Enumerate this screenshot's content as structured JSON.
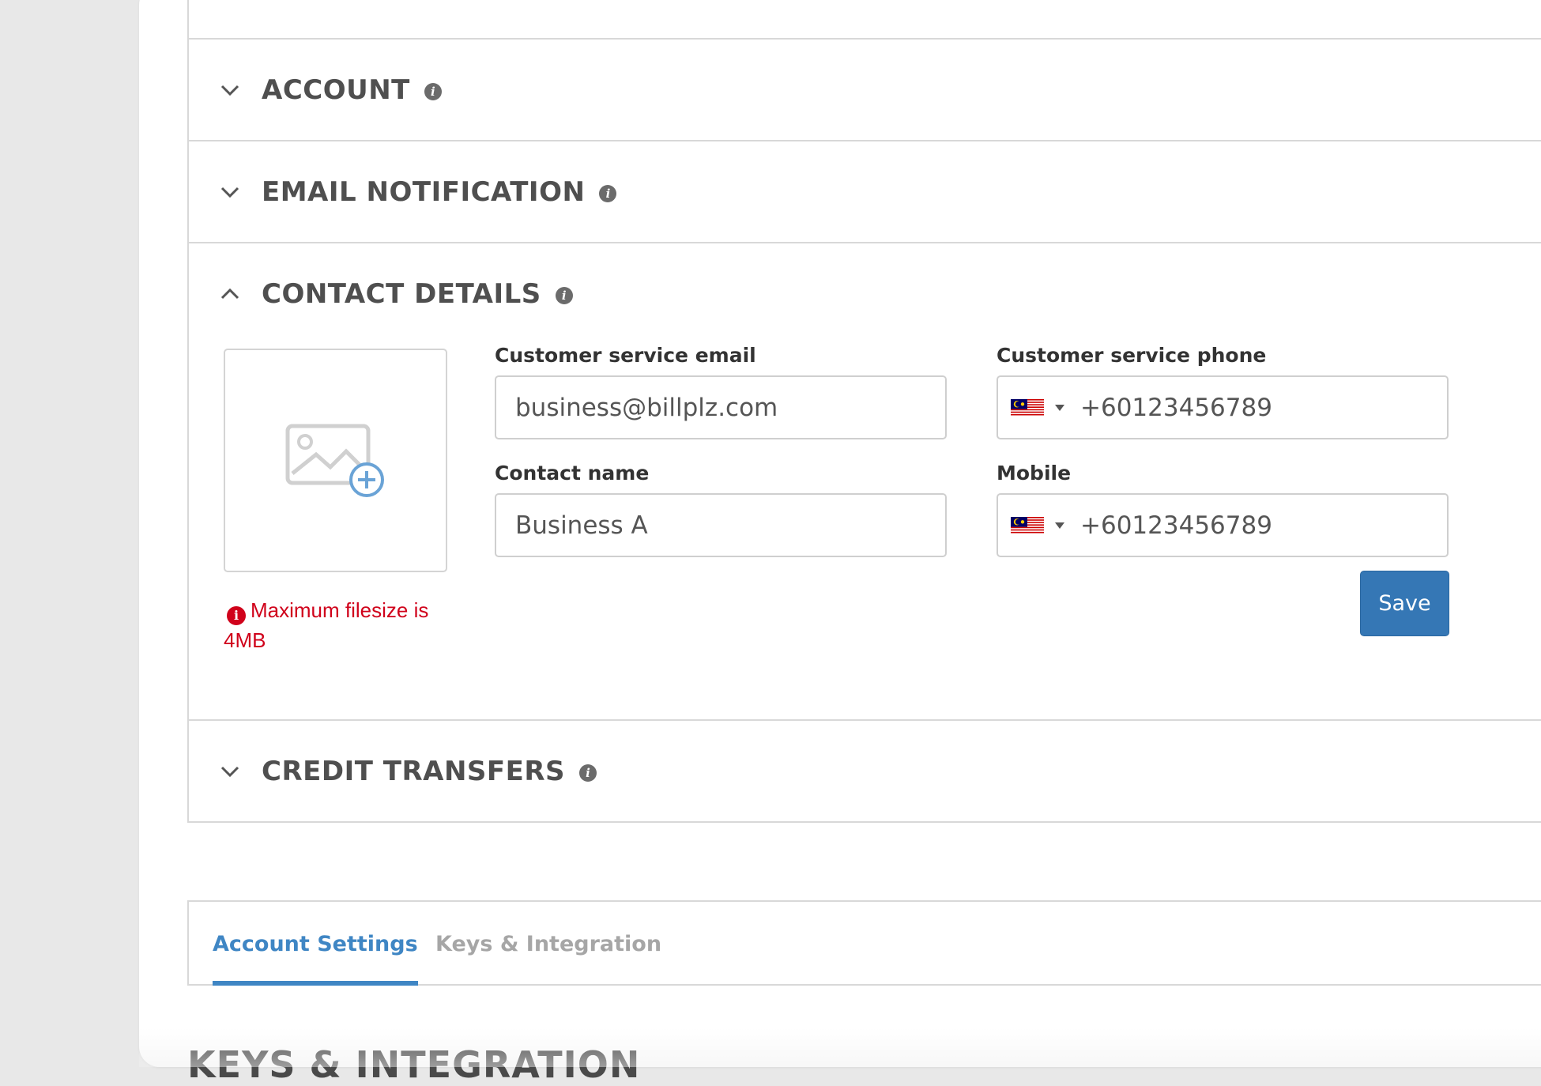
{
  "sections": [
    {
      "title": "ACCOUNT",
      "expanded": false,
      "icon": "chevron-down-icon"
    },
    {
      "title": "EMAIL NOTIFICATION",
      "expanded": false,
      "icon": "chevron-down-icon"
    },
    {
      "title": "CONTACT DETAILS",
      "expanded": true,
      "icon": "chevron-up-icon"
    },
    {
      "title": "CREDIT TRANSFERS",
      "expanded": false,
      "icon": "chevron-down-icon"
    }
  ],
  "contact": {
    "upload_note": "Maximum filesize is 4MB",
    "email_label": "Customer service email",
    "email_value": "business@billplz.com",
    "phone_label": "Customer service phone",
    "phone_value": "+60123456789",
    "name_label": "Contact name",
    "name_value": "Business A",
    "mobile_label": "Mobile",
    "mobile_value": "+60123456789",
    "save_label": "Save"
  },
  "tabs": [
    {
      "label": "Account Settings",
      "active": true
    },
    {
      "label": "Keys & Integration",
      "active": false
    }
  ],
  "next_section_title": "KEYS & INTEGRATION",
  "colors": {
    "accent": "#3f86c4",
    "button": "#3577b5",
    "error": "#d0021b"
  }
}
